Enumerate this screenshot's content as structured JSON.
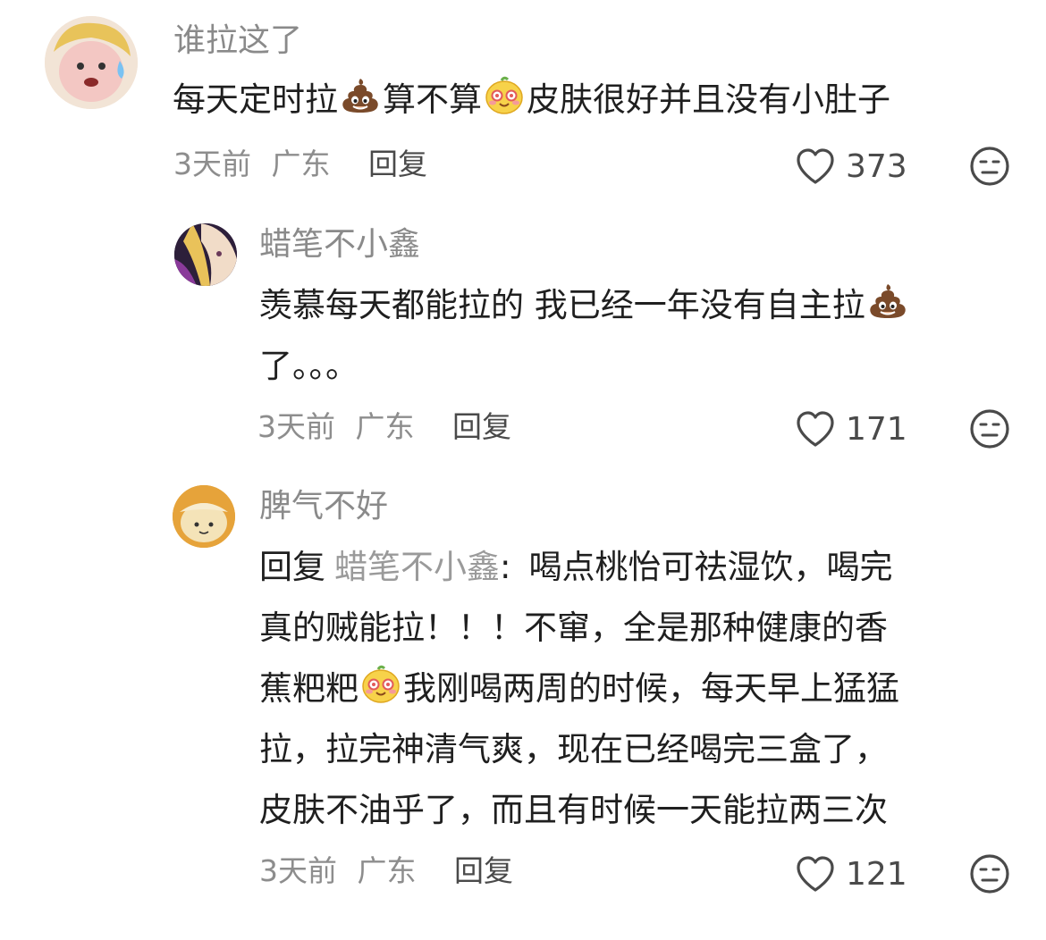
{
  "comments": [
    {
      "username": "谁拉这了",
      "segments": [
        "每天定时拉",
        "算不算",
        "皮肤很好并且没有小肚子"
      ],
      "time": "3天前",
      "location": "广东",
      "reply_label": "回复",
      "likes": "373"
    },
    {
      "username": "蜡笔不小鑫",
      "line1": "羡慕每天都能拉的 我已经一年没有自主拉",
      "line2": "了。。。",
      "time": "3天前",
      "location": "广东",
      "reply_label": "回复",
      "likes": "171"
    },
    {
      "username": "脾气不好",
      "reply_prefix": "回复",
      "reply_target": "蜡笔不小鑫",
      "reply_colon": ":",
      "line1": "喝点桃怡可祛湿饮，喝完",
      "line2": "真的贼能拉！！！不窜，全是那种健康的香",
      "line3a": "蕉粑粑",
      "line3b": "我刚喝两周的时候，每天早上猛猛",
      "line4": "拉，拉完神清气爽，现在已经喝完三盒了，",
      "line5": "皮肤不油乎了，而且有时候一天能拉两三次",
      "time": "3天前",
      "location": "广东",
      "reply_label": "回复",
      "likes": "121"
    }
  ],
  "icons": {
    "like": "heart-outline-icon",
    "dislike": "meh-face-icon",
    "emoji_poop": "poop-emoji",
    "emoji_face": "cute-face-emoji"
  },
  "colors": {
    "username": "#8a8a8a",
    "meta": "#8d8d8d",
    "text": "#1f1f1f"
  }
}
